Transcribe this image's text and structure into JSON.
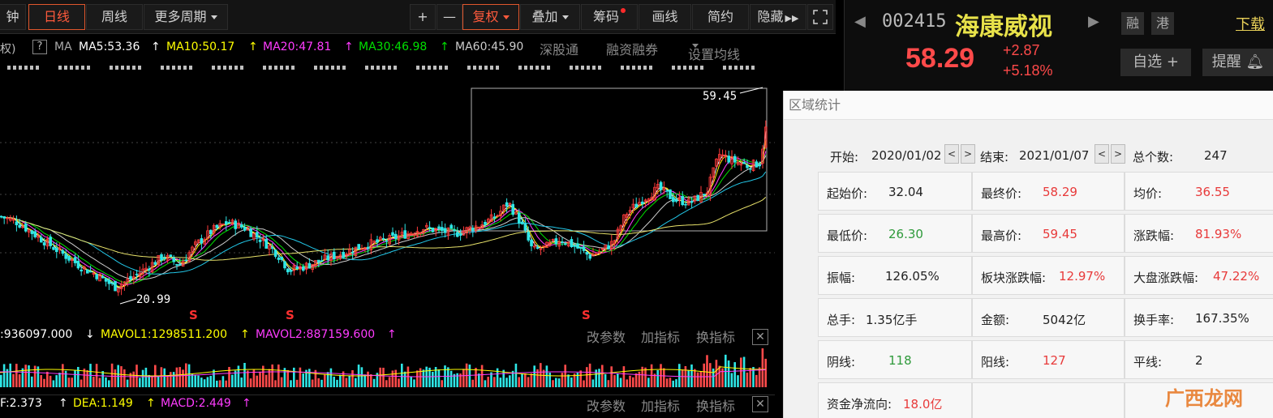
{
  "toolbar": {
    "left_partial": "钟",
    "daily": "日线",
    "weekly": "周线",
    "more_periods": "更多周期",
    "plus": "+",
    "minus": "—",
    "restore_rights": "复权",
    "overlay": "叠加",
    "chips": "筹码",
    "draw": "画线",
    "simple": "简约",
    "hide": "隐藏"
  },
  "ma_bar": {
    "prefix": "权)",
    "help": "?",
    "ma_label": "MA",
    "ma5": "MA5:53.36",
    "ma10": "MA10:50.17",
    "ma20": "MA20:47.81",
    "ma30": "MA30:46.98",
    "ma60": "MA60:45.90",
    "connect": "深股通",
    "margin": "融资融券",
    "set_ma": "设置均线",
    "colors": {
      "ma5": "#ffffff",
      "ma10": "#ffff00",
      "ma20": "#ff3cff",
      "ma30": "#00e000",
      "ma60": "#cccccc"
    }
  },
  "kline": {
    "high_label": "59.45",
    "low_label": "20.99",
    "signal_mark": "S"
  },
  "chart_data": {
    "type": "candlestick",
    "x_start": "2020/01/02",
    "x_end": "2021/01/07",
    "ylim": [
      19,
      62
    ],
    "price_path": [
      [
        0,
        34
      ],
      [
        20,
        33
      ],
      [
        50,
        30
      ],
      [
        80,
        27
      ],
      [
        100,
        25
      ],
      [
        120,
        23.5
      ],
      [
        140,
        21.5
      ],
      [
        160,
        23
      ],
      [
        180,
        25
      ],
      [
        200,
        27
      ],
      [
        220,
        25.5
      ],
      [
        240,
        29
      ],
      [
        260,
        31.5
      ],
      [
        280,
        33
      ],
      [
        300,
        32
      ],
      [
        320,
        30
      ],
      [
        340,
        27.5
      ],
      [
        355,
        24.5
      ],
      [
        370,
        25
      ],
      [
        390,
        26
      ],
      [
        420,
        27.5
      ],
      [
        450,
        29
      ],
      [
        480,
        30
      ],
      [
        500,
        31
      ],
      [
        520,
        32
      ],
      [
        540,
        31.5
      ],
      [
        560,
        31
      ],
      [
        590,
        32.5
      ],
      [
        610,
        34
      ],
      [
        625,
        36.5
      ],
      [
        640,
        33
      ],
      [
        655,
        28
      ],
      [
        670,
        28.5
      ],
      [
        690,
        30
      ],
      [
        710,
        28.5
      ],
      [
        725,
        27
      ],
      [
        740,
        28
      ],
      [
        755,
        29.5
      ],
      [
        770,
        34.5
      ],
      [
        790,
        37
      ],
      [
        810,
        39
      ],
      [
        830,
        37
      ],
      [
        850,
        36.5
      ],
      [
        870,
        38.5
      ],
      [
        885,
        45
      ],
      [
        900,
        44
      ],
      [
        920,
        43
      ],
      [
        935,
        43.5
      ],
      [
        943,
        50
      ],
      [
        946,
        58.29
      ]
    ]
  },
  "volume": {
    "label1": ":936097.000",
    "label2": "MAVOL1:1298511.200",
    "label3": "MAVOL2:887159.600",
    "modify": "改参数",
    "add": "加指标",
    "switch": "换指标",
    "close": "✕"
  },
  "macd": {
    "label1": "F:2.373",
    "label2": "DEA:1.149",
    "label3": "MACD:2.449",
    "modify": "改参数",
    "add": "加指标",
    "switch": "换指标",
    "close": "✕"
  },
  "quote": {
    "code": "002415",
    "name": "海康威视",
    "price": "58.29",
    "change": "+2.87",
    "change_pct": "+5.18%",
    "tag_margin": "融",
    "tag_hk": "港",
    "download": "下载",
    "watchlist": "自选",
    "watchlist_plus": "+",
    "remind": "提醒"
  },
  "stats": {
    "title": "区域统计",
    "start_label": "开始:",
    "start_date": "2020/01/02",
    "end_label": "结束:",
    "end_date": "2021/01/07",
    "total_label": "总个数:",
    "total": "247",
    "prev": "<",
    "next": ">",
    "rows": [
      [
        {
          "label": "起始价:",
          "value": "32.04",
          "color": "#222222"
        },
        {
          "label": "最终价:",
          "value": "58.29",
          "color": "#e83a3a"
        },
        {
          "label": "均价:",
          "value": "36.55",
          "color": "#e83a3a"
        }
      ],
      [
        {
          "label": "最低价:",
          "value": "26.30",
          "color": "#2f9a3b"
        },
        {
          "label": "最高价:",
          "value": "59.45",
          "color": "#e83a3a"
        },
        {
          "label": "涨跌幅:",
          "value": "81.93%",
          "color": "#e83a3a"
        }
      ],
      [
        {
          "label": "振幅:",
          "value": "126.05%",
          "color": "#222222"
        },
        {
          "label": "板块涨跌幅:",
          "value": "12.97%",
          "color": "#e83a3a"
        },
        {
          "label": "大盘涨跌幅:",
          "value": "47.22%",
          "color": "#e83a3a"
        }
      ],
      [
        {
          "label": "总手:",
          "value": "1.35亿手",
          "color": "#222222"
        },
        {
          "label": "金额:",
          "value": "5042亿",
          "color": "#222222"
        },
        {
          "label": "换手率:",
          "value": "167.35%",
          "color": "#222222"
        }
      ],
      [
        {
          "label": "阴线:",
          "value": "118",
          "color": "#2f9a3b"
        },
        {
          "label": "阳线:",
          "value": "127",
          "color": "#e83a3a"
        },
        {
          "label": "平线:",
          "value": "2",
          "color": "#222222"
        }
      ],
      [
        {
          "label": "资金净流向:",
          "value": "18.0亿",
          "color": "#e83a3a"
        },
        {
          "label": "",
          "value": "",
          "color": "#222222"
        },
        {
          "label": "",
          "value": "",
          "color": "#222222"
        }
      ]
    ]
  },
  "watermark": "广西龙网"
}
